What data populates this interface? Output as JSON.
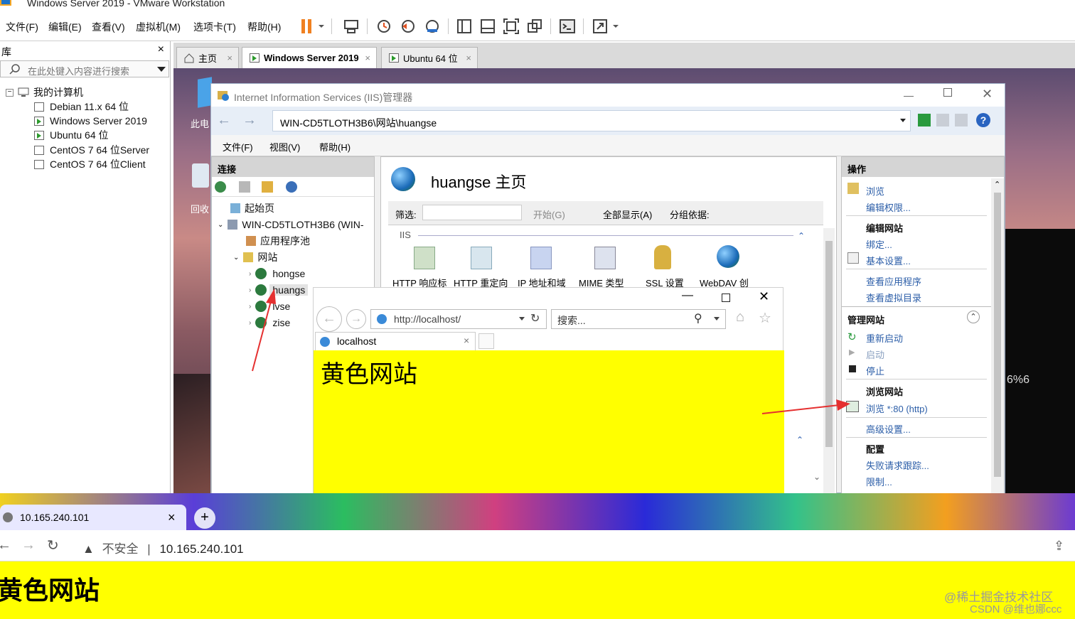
{
  "vmware": {
    "title": "Windows Server 2019 - VMware Workstation",
    "menu": [
      "文件(F)",
      "编辑(E)",
      "查看(V)",
      "虚拟机(M)",
      "选项卡(T)",
      "帮助(H)"
    ],
    "library": {
      "title": "库",
      "close": "×",
      "search_placeholder": "在此处键入内容进行搜索",
      "root": "我的计算机",
      "vms": [
        "Debian 11.x 64 位",
        "Windows Server 2019",
        "Ubuntu 64 位",
        "CentOS 7 64 位Server",
        "CentOS 7 64 位Client"
      ]
    },
    "tabs": [
      {
        "label": "主页"
      },
      {
        "label": "Windows Server 2019"
      },
      {
        "label": "Ubuntu 64 位"
      }
    ],
    "tab_close": "×"
  },
  "desktop": {
    "icon1": "此电",
    "icon2": "回收",
    "right_text": "6%6"
  },
  "iis": {
    "title": "Internet Information Services (IIS)管理器",
    "address": "WIN-CD5TLOTH3B6\\网站\\huangse",
    "menu": [
      "文件(F)",
      "视图(V)",
      "帮助(H)"
    ],
    "connections": {
      "header": "连接",
      "items": [
        "起始页",
        "WIN-CD5TLOTH3B6 (WIN-",
        "应用程序池",
        "网站",
        "hongse",
        "huangs",
        "lvse",
        "zise"
      ]
    },
    "home": {
      "title": "huangse 主页",
      "filter_label": "筛选:",
      "start": "开始(G)",
      "show_all": "全部显示(A)",
      "group_by": "分组依据:",
      "section": "IIS",
      "features": [
        "HTTP 响应标",
        "HTTP 重定向",
        "IP 地址和域",
        "MIME 类型",
        "SSL 设置",
        "WebDAV 创"
      ]
    },
    "actions": {
      "header": "操作",
      "browse": "浏览",
      "edit_perms": "编辑权限...",
      "edit_site_h": "编辑网站",
      "bindings": "绑定...",
      "basic_settings": "基本设置...",
      "view_apps": "查看应用程序",
      "view_vdirs": "查看虚拟目录",
      "manage_site_h": "管理网站",
      "restart": "重新启动",
      "start": "启动",
      "stop": "停止",
      "browse_site_h": "浏览网站",
      "browse_80": "浏览 *:80 (http)",
      "advanced": "高级设置...",
      "config_h": "配置",
      "failed_req": "失败请求跟踪...",
      "limits": "限制..."
    }
  },
  "ie": {
    "url": "http://localhost/",
    "search_placeholder": "搜索...",
    "tab": "localhost",
    "page_text": "黄色网站"
  },
  "chrome": {
    "tab": "10.165.240.101",
    "tab_close": "×",
    "new_tab": "+",
    "insecure": "不安全",
    "url": "10.165.240.101",
    "page_text": "黄色网站"
  },
  "watermark": {
    "line1": "@稀土掘金技术社区",
    "line2": "CSDN @维也娜ccc"
  }
}
